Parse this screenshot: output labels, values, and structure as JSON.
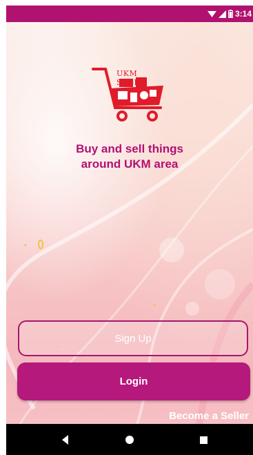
{
  "status_bar": {
    "time": "3:14",
    "color": "#b0126f"
  },
  "logo": {
    "text": "UKM STORE",
    "icon": "shopping-cart-logo"
  },
  "tagline": {
    "line1": "Buy and sell things",
    "line2": "around UKM area"
  },
  "buttons": {
    "signup_label": "Sign Up",
    "login_label": "Login",
    "seller_label": "Become a Seller"
  },
  "colors": {
    "accent": "#b5197b",
    "tagline": "#b30f74"
  },
  "nav": {
    "back_icon": "back-triangle-icon",
    "home_icon": "home-circle-icon",
    "recents_icon": "recents-square-icon"
  }
}
